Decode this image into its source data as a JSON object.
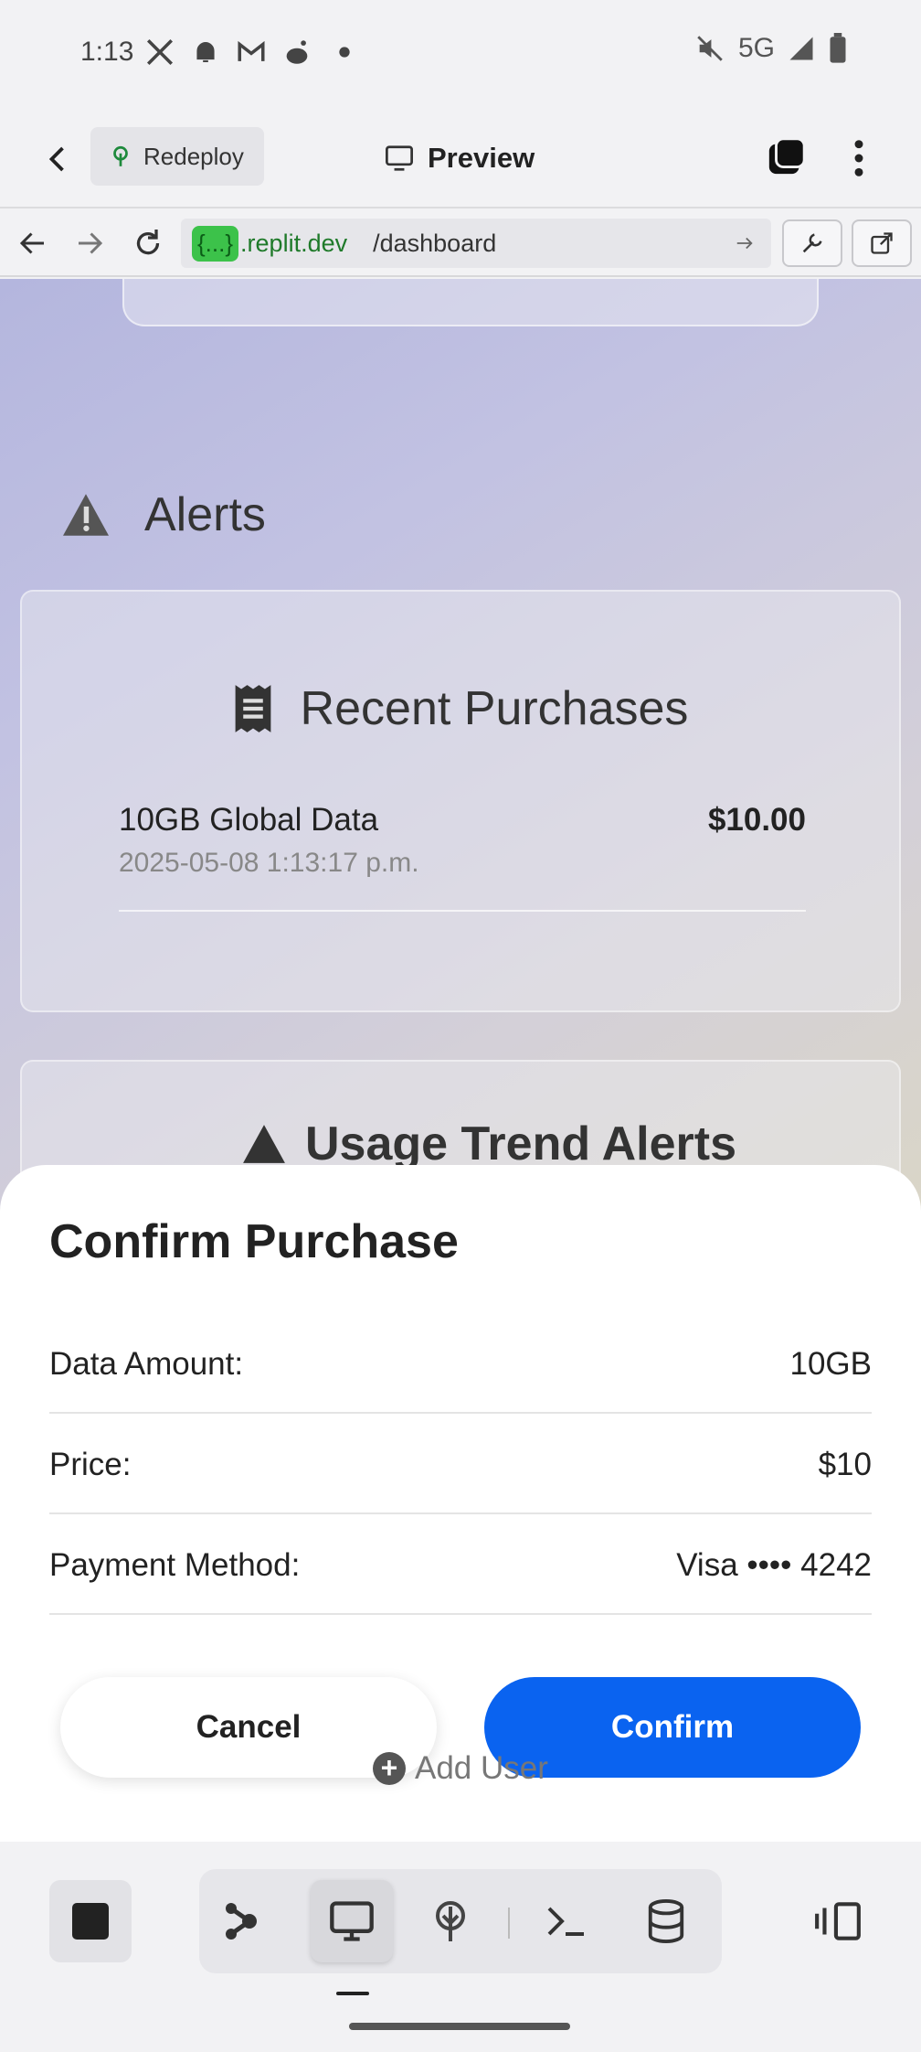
{
  "status_bar": {
    "time": "1:13",
    "network": "5G",
    "icons": [
      "x-icon",
      "bell-icon",
      "gmail-icon",
      "reddit-icon",
      "dot-icon",
      "mute-icon",
      "signal-icon",
      "battery-icon"
    ]
  },
  "top_bar": {
    "redeploy_label": "Redeploy",
    "preview_label": "Preview"
  },
  "url_bar": {
    "host_pill": "{...}",
    "host": ".replit.dev",
    "path": "/dashboard"
  },
  "app": {
    "alerts_title": "Alerts",
    "recent_purchases": {
      "title": "Recent Purchases",
      "items": [
        {
          "name": "10GB Global Data",
          "date": "2025-05-08 1:13:17 p.m.",
          "price": "$10.00"
        }
      ]
    },
    "usage_alerts_title": "Usage Trend Alerts"
  },
  "confirm_sheet": {
    "title": "Confirm Purchase",
    "rows": [
      {
        "label": "Data Amount:",
        "value": "10GB"
      },
      {
        "label": "Price:",
        "value": "$10"
      },
      {
        "label": "Payment Method:",
        "value": "Visa •••• 4242"
      }
    ],
    "cancel_label": "Cancel",
    "confirm_label": "Confirm",
    "add_user_label": "Add User"
  },
  "colors": {
    "confirm_blue": "#0a63f0",
    "host_green": "#3cc24a",
    "redeploy_green": "#1e8a3c"
  }
}
